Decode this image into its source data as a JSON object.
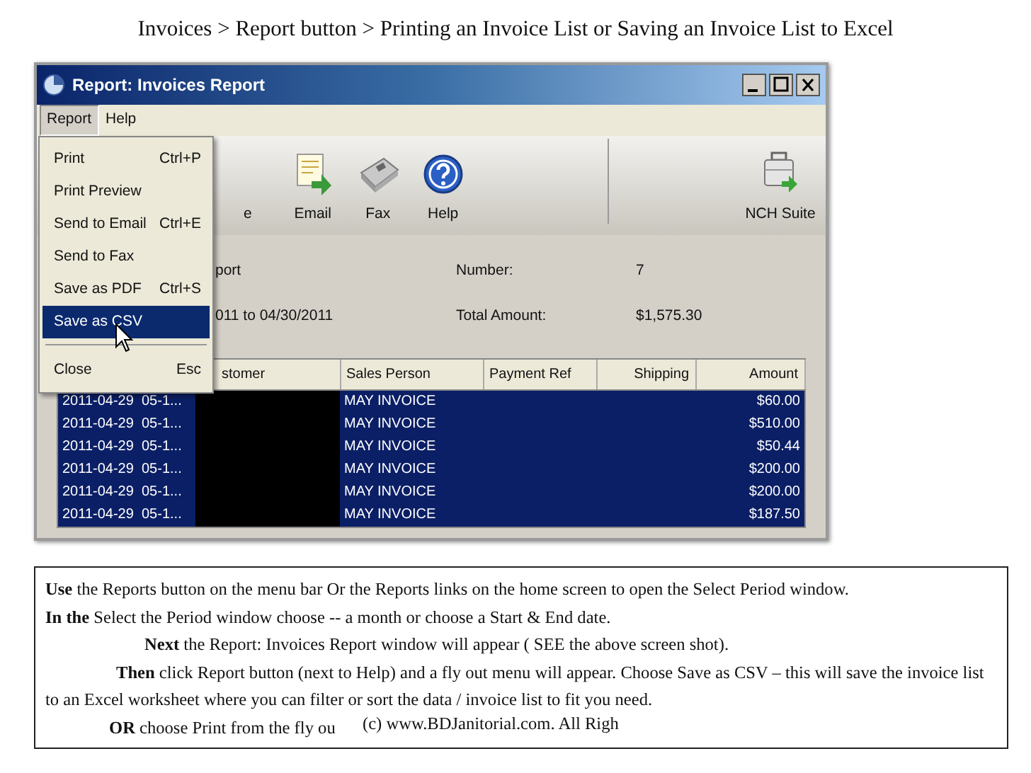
{
  "caption": "Invoices > Report button  > Printing an Invoice List or Saving an Invoice List to Excel",
  "window": {
    "title": "Report: Invoices Report"
  },
  "menubar": [
    {
      "label": "Report",
      "selected": true
    },
    {
      "label": "Help",
      "selected": false
    }
  ],
  "toolbar": [
    {
      "kind": "partial",
      "label": "e"
    },
    {
      "kind": "email",
      "label": "Email"
    },
    {
      "kind": "fax",
      "label": "Fax"
    },
    {
      "kind": "help",
      "label": "Help"
    },
    {
      "kind": "suite",
      "label": "NCH Suite"
    }
  ],
  "info": {
    "left": [
      "port",
      "011 to 04/30/2011"
    ],
    "fields": [
      {
        "label": "Number:",
        "value": "7"
      },
      {
        "label": "Total Amount:",
        "value": "$1,575.30"
      }
    ]
  },
  "table": {
    "headers": [
      "stomer",
      "Sales Person",
      "Payment Ref",
      "Shipping",
      "Amount"
    ],
    "rows": [
      {
        "date": "2011-04-29",
        "column_2": "05-1...",
        "redacted": true,
        "sales_person": "MAY INVOICE",
        "amount": "$60.00",
        "selected": true
      },
      {
        "date": "2011-04-29",
        "column_2": "05-1...",
        "redacted": true,
        "sales_person": "MAY INVOICE",
        "amount": "$510.00",
        "selected": true
      },
      {
        "date": "2011-04-29",
        "column_2": "05-1...",
        "redacted": true,
        "sales_person": "MAY INVOICE",
        "amount": "$50.44",
        "selected": true
      },
      {
        "date": "2011-04-29",
        "column_2": "05-1...",
        "redacted": true,
        "sales_person": "MAY INVOICE",
        "amount": "$200.00",
        "selected": true
      },
      {
        "date": "2011-04-29",
        "column_2": "05-1...",
        "redacted": true,
        "sales_person": "MAY INVOICE",
        "amount": "$200.00",
        "selected": true
      },
      {
        "date": "2011-04-29",
        "column_2": "05-1...",
        "redacted": true,
        "sales_person": "MAY INVOICE",
        "amount": "$187.50",
        "selected": true
      }
    ]
  },
  "menu": [
    {
      "kind": "item",
      "label": "Print",
      "shortcut": "Ctrl+P",
      "selected": false
    },
    {
      "kind": "item",
      "label": "Print Preview",
      "selected": false
    },
    {
      "kind": "item",
      "label": "Send to Email",
      "shortcut": "Ctrl+E",
      "selected": false
    },
    {
      "kind": "item",
      "label": "Send to Fax",
      "selected": false
    },
    {
      "kind": "item",
      "label": "Save as PDF",
      "shortcut": "Ctrl+S",
      "selected": false
    },
    {
      "kind": "item",
      "label": "Save as CSV",
      "selected": true
    },
    {
      "kind": "separator"
    },
    {
      "kind": "item",
      "label": "Close",
      "shortcut": "Esc",
      "selected": false
    }
  ],
  "instructions": [
    "**Use** the Reports button on the menu bar Or the Reports links on the home screen to open the Select Period window.",
    "**In the** Select the Period window choose -- a month or choose a Start & End date.",
    "**Next** the Report: Invoices Report window will appear ( SEE the above screen shot).",
    "**Then** click Report button (next to Help) and a fly out menu will appear. Choose Save as CSV – this will save the  invoice list to an Excel worksheet where you can filter or sort the data / invoice list to fit you need.",
    "**OR** choose Print from the fly ou"
  ],
  "copyright": "(c) www.BDJanitorial.com.  All Righ"
}
